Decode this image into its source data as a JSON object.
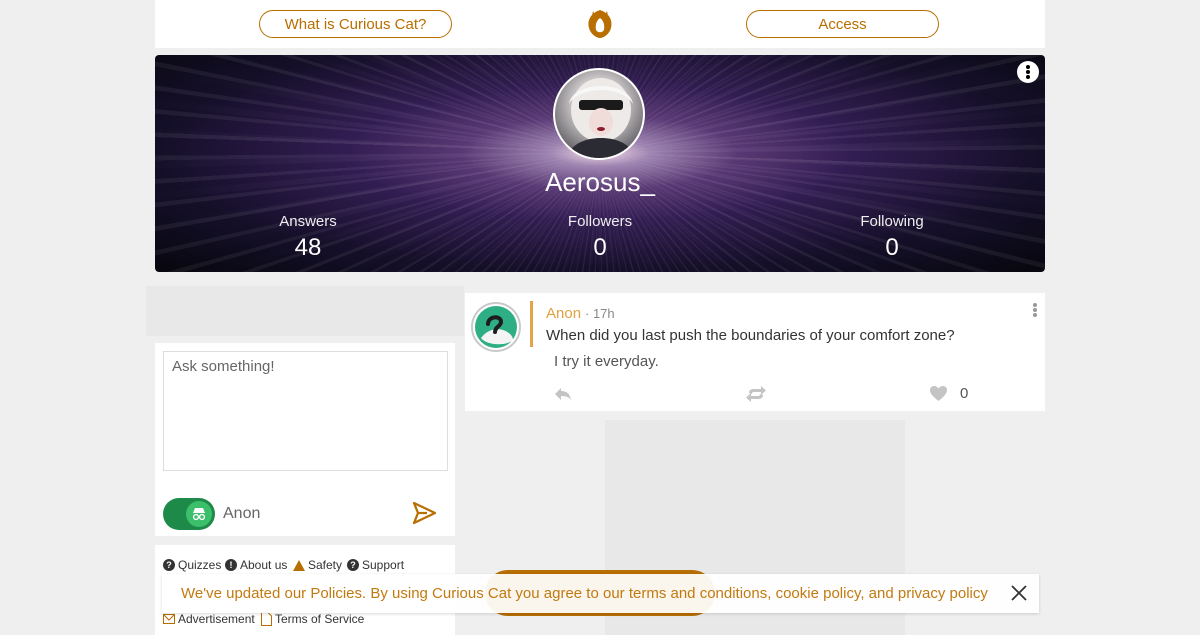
{
  "nav": {
    "what_is_label": "What is Curious Cat?",
    "access_label": "Access"
  },
  "profile": {
    "username": "Aerosus_",
    "stats": [
      {
        "label": "Answers",
        "value": "48"
      },
      {
        "label": "Followers",
        "value": "0"
      },
      {
        "label": "Following",
        "value": "0"
      }
    ]
  },
  "ask": {
    "placeholder": "Ask something!",
    "anon_label": "Anon"
  },
  "footer_links": {
    "quizzes": "Quizzes",
    "about": "About us",
    "safety": "Safety",
    "support": "Support",
    "advertisement": "Advertisement",
    "terms": "Terms of Service"
  },
  "post": {
    "author": "Anon",
    "time": "· 17h",
    "question": "When did you last push the boundaries of your comfort zone?",
    "answer": "I try it everyday.",
    "likes": "0"
  },
  "notice": {
    "text": "We've updated our Policies. By using Curious Cat you agree to our terms and conditions, cookie policy, and privacy policy"
  },
  "colors": {
    "brand": "#b86e00",
    "toggle_on": "#1e8a4a"
  }
}
